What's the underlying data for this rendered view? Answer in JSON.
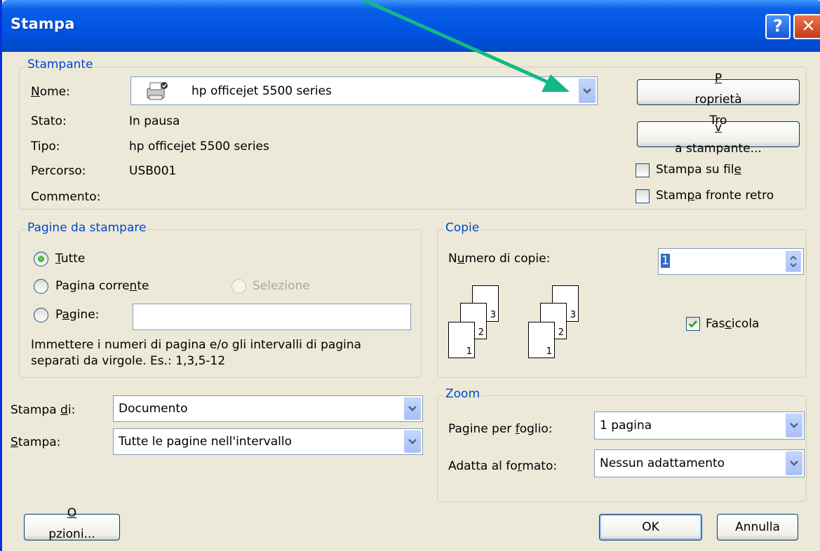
{
  "window": {
    "title": "Stampa"
  },
  "titlebar": {
    "help_glyph": "?",
    "close_glyph": "✕"
  },
  "printer": {
    "legend": "Stampante",
    "name_label": "Nome:",
    "name_value": "hp officejet 5500 series",
    "status_label": "Stato:",
    "status_value": "In pausa",
    "type_label": "Tipo:",
    "type_value": "hp officejet 5500 series",
    "path_label": "Percorso:",
    "path_value": "USB001",
    "comment_label": "Commento:",
    "properties_button": "Proprietà",
    "find_printer_button": "Trova stampante...",
    "print_to_file": "Stampa su file",
    "duplex": "Stampa fronte retro",
    "print_to_file_checked": false,
    "duplex_checked": false
  },
  "pages": {
    "legend": "Pagine da stampare",
    "all": "Tutte",
    "current": "Pagina corrente",
    "selection": "Selezione",
    "pages": "Pagine:",
    "pages_value": "",
    "selected": "all",
    "hint_line1": "Immettere i numeri di pagina e/o gli intervalli di pagina",
    "hint_line2": "separati da virgole. Es.: 1,3,5-12"
  },
  "copies": {
    "legend": "Copie",
    "count_label": "Numero di copie:",
    "count_value": "1",
    "collate": "Fascicola",
    "collate_checked": true,
    "page_numbers": [
      "1",
      "2",
      "3"
    ]
  },
  "print_what": {
    "label": "Stampa di:",
    "value": "Documento"
  },
  "print_range": {
    "label": "Stampa:",
    "value": "Tutte le pagine nell'intervallo"
  },
  "zoom": {
    "legend": "Zoom",
    "pages_per_sheet_label": "Pagine per foglio:",
    "pages_per_sheet_value": "1 pagina",
    "scale_label": "Adatta al formato:",
    "scale_value": "Nessun adattamento"
  },
  "buttons": {
    "options": "Opzioni...",
    "ok": "OK",
    "cancel": "Annulla"
  },
  "annotation": {
    "arrow_color": "#12b886"
  }
}
